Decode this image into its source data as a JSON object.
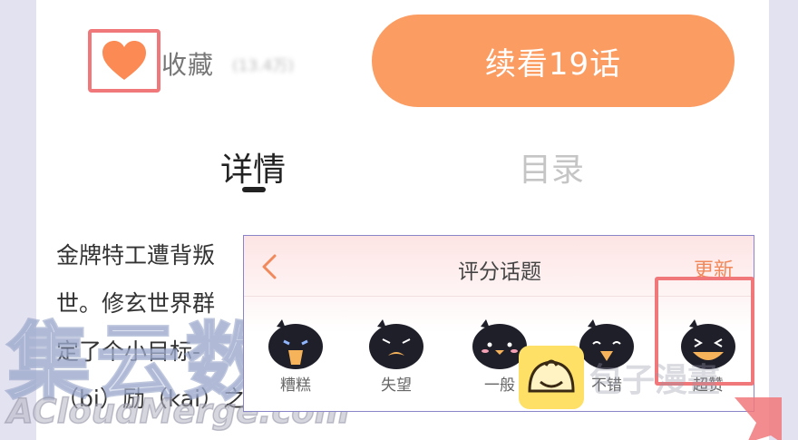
{
  "header": {
    "favorite_label": "收藏",
    "favorite_count": "(13.4万)",
    "continue_label": "续看19话"
  },
  "tabs": [
    {
      "label": "详情",
      "active": true
    },
    {
      "label": "目录",
      "active": false
    }
  ],
  "description": {
    "line1": "金牌特工遭背叛",
    "line2": "世。修玄世界群",
    "line3": "定了个小目标-",
    "line4": "（bi）励（kai）之"
  },
  "rating_popup": {
    "title": "评分话题",
    "refresh_label": "更新",
    "options": [
      {
        "label": "糟糕",
        "icon": "crying-bird-icon"
      },
      {
        "label": "失望",
        "icon": "frowning-bird-icon"
      },
      {
        "label": "一般",
        "icon": "neutral-bird-icon"
      },
      {
        "label": "不错",
        "icon": "smiling-bird-icon"
      },
      {
        "label": "超赞",
        "icon": "laughing-bird-icon"
      }
    ]
  },
  "watermarks": {
    "main": "集云数据",
    "sub": "ACloudMerge.com",
    "right": "包子漫畫"
  },
  "colors": {
    "accent": "#fb9c62",
    "highlight": "#f0787a",
    "heart": "#fc8a55"
  }
}
